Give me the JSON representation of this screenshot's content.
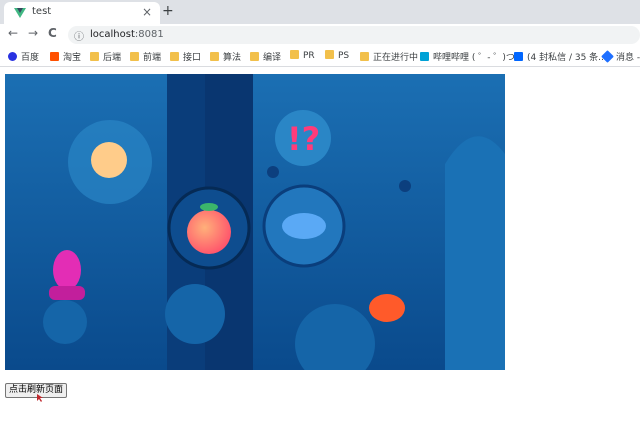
{
  "tab": {
    "title": "test",
    "close_icon": "×",
    "new_tab_icon": "+"
  },
  "toolbar": {
    "back": "←",
    "forward": "→",
    "reload": "C"
  },
  "address": {
    "info_icon": "ⓘ",
    "host": "localhost",
    "port": ":8081"
  },
  "bookmarks": [
    {
      "label": "百度",
      "icon": "baidu-icon",
      "color": "#2932e1"
    },
    {
      "label": "淘宝",
      "icon": "taobao-icon",
      "color": "#ff5000"
    },
    {
      "label": "后端",
      "icon": "folder-icon"
    },
    {
      "label": "前端",
      "icon": "folder-icon"
    },
    {
      "label": "接口",
      "icon": "folder-icon"
    },
    {
      "label": "算法",
      "icon": "folder-icon"
    },
    {
      "label": "编译",
      "icon": "folder-icon"
    },
    {
      "label": "PR",
      "icon": "folder-icon"
    },
    {
      "label": "PS",
      "icon": "folder-icon"
    },
    {
      "label": "正在进行中",
      "icon": "folder-icon"
    },
    {
      "label": "哔哩哔哩 ( ゜- ゜)つ...",
      "icon": "bilibili-icon",
      "color": "#00a1d6"
    },
    {
      "label": "(4 封私信 / 35 条...",
      "icon": "zhihu-icon",
      "color": "#0066ff"
    },
    {
      "label": "消息 -",
      "icon": "message-icon",
      "color": "#1e6fff"
    }
  ],
  "page": {
    "refresh_button": "点击刷新页面"
  },
  "colors": {
    "hero_bg": "#0d5a9e",
    "hero_dark": "#0a3d7a",
    "accent": "#1a73e8"
  }
}
